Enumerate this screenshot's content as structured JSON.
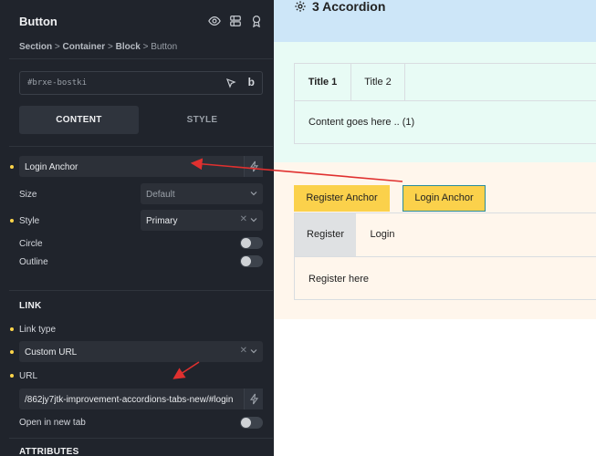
{
  "panel": {
    "title": "Button",
    "breadcrumb": {
      "section": "Section",
      "container": "Container",
      "block": "Block",
      "current": "Button",
      "sep": ">"
    },
    "element_id": "#brxe-bostki",
    "id_suffix_letter": "b",
    "tabs": {
      "content": "CONTENT",
      "style": "STYLE"
    },
    "text_value": "Login Anchor",
    "fields": {
      "size": {
        "label": "Size",
        "value": "Default"
      },
      "style": {
        "label": "Style",
        "value": "Primary"
      },
      "circle": {
        "label": "Circle"
      },
      "outline": {
        "label": "Outline"
      }
    },
    "link_section": {
      "title": "LINK",
      "link_type": {
        "label": "Link type",
        "value": "Custom URL"
      },
      "url": {
        "label": "URL",
        "value": "/862jy7jtk-improvement-accordions-tabs-new/#login"
      },
      "new_tab": {
        "label": "Open in new tab"
      }
    },
    "attributes_title": "ATTRIBUTES"
  },
  "canvas": {
    "section_title": "3 Accordion",
    "tabs": [
      "Title 1",
      "Title 2"
    ],
    "tab_content": "Content goes here .. (1)",
    "buttons": [
      "Register Anchor",
      "Login Anchor"
    ],
    "tabs2": [
      "Register",
      "Login"
    ],
    "tab2_content": "Register here"
  },
  "colors": {
    "panel_bg": "#20242c",
    "accent_dot": "#ffd54a",
    "annotation_arrow": "#e0302f",
    "button_yellow": "#fbd14b"
  }
}
